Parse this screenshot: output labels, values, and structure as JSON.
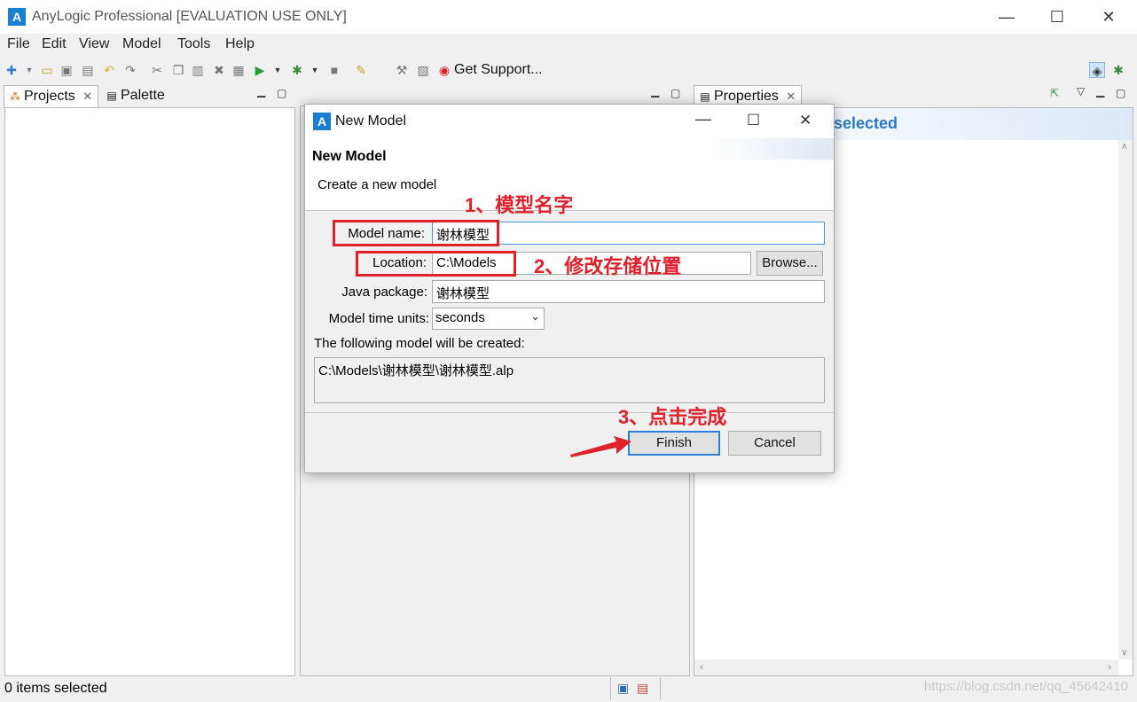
{
  "window": {
    "title": "AnyLogic Professional [EVALUATION USE ONLY]",
    "minimize": "—",
    "maximize": "☐",
    "close": "✕"
  },
  "menu": [
    "File",
    "Edit",
    "View",
    "Model",
    "Tools",
    "Help"
  ],
  "toolbar": {
    "support_label": "Get Support..."
  },
  "left_panel": {
    "tab_projects": "Projects",
    "tab_palette": "Palette"
  },
  "right_panel": {
    "tab_properties": "Properties",
    "header_text": "selected"
  },
  "status": {
    "text": "0 items selected",
    "watermark": "https://blog.csdn.net/qq_45642410"
  },
  "dialog": {
    "title": "New Model",
    "header_title": "New Model",
    "header_desc": "Create a new model",
    "model_name_label": "Model name:",
    "model_name_value": "谢林模型",
    "location_label": "Location:",
    "location_value": "C:\\Models",
    "browse_label": "Browse...",
    "java_package_label": "Java package:",
    "java_package_value": "谢林模型",
    "time_units_label": "Model time units:",
    "time_units_value": "seconds",
    "summary_label": "The following model will be created:",
    "summary_value": "C:\\Models\\谢林模型\\谢林模型.alp",
    "finish_label": "Finish",
    "cancel_label": "Cancel"
  },
  "annotations": {
    "step1": "1、模型名字",
    "step2": "2、修改存储位置",
    "step3": "3、点击完成"
  },
  "colors": {
    "accent": "#1a7fd0",
    "annotation": "#e0202a"
  }
}
